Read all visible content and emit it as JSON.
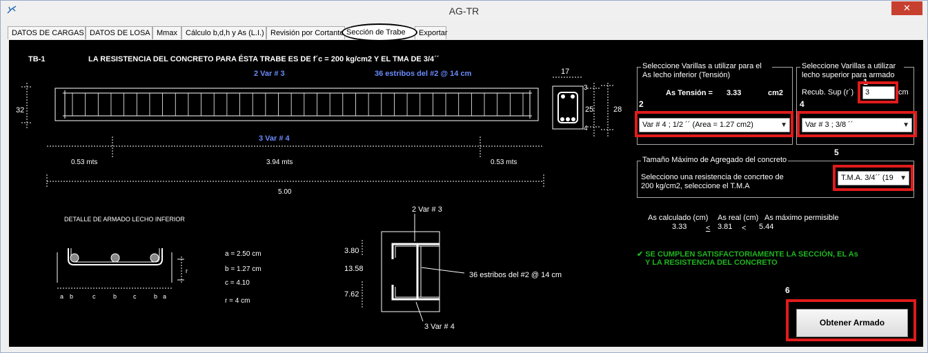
{
  "window": {
    "title": "AG-TR",
    "close_label": "✕"
  },
  "tabs": [
    {
      "label": "DATOS DE CARGAS"
    },
    {
      "label": "DATOS DE LOSA"
    },
    {
      "label": "Mmax"
    },
    {
      "label": "Cálculo b,d,h y As (L.I.)"
    },
    {
      "label": "Revisión por Cortante"
    },
    {
      "label": "Sección de Trabe"
    },
    {
      "label": "Exportar"
    }
  ],
  "header": {
    "beam_id": "TB-1",
    "resistance_text": "LA RESISTENCIA DEL CONCRETO PARA ÉSTA TRABE ES DE f´c = 200 kg/cm2 Y EL TMA DE 3/4´´",
    "top_bars": "2  Var # 3",
    "stirrups": "36 estribos del #2 @ 14 cm",
    "bottom_bars": "3  Var # 4"
  },
  "elevation": {
    "height_label": "32",
    "left_len": "0.53 mts",
    "mid_len": "3.94 mts",
    "right_len": "0.53 mts",
    "total_len": "5.00",
    "stirrup_count": 36
  },
  "cross_section": {
    "width": "17",
    "top_cover": "3",
    "inner_height": "25",
    "total_height": "28",
    "bottom_cover": "4"
  },
  "detail": {
    "title": "DETALLE DE ARMADO LECHO INFERIOR",
    "a": "a = 2.50 cm",
    "b": "b = 1.27 cm",
    "c": "c = 4.10",
    "r": "r = 4 cm",
    "r_label": "r",
    "dim_letters": [
      "a",
      "b",
      "c",
      "b",
      "c",
      "b",
      "a"
    ]
  },
  "long_section": {
    "top_label": "2   Var # 3",
    "d1": "3.80",
    "d2": "13.58",
    "d3": "7.62",
    "stirrups": "36 estribos del #2 @ 14 cm",
    "bottom_label": "3   Var # 4"
  },
  "group_bottom": {
    "label": "Seleccione Varillas a utilizar para el As lecho inferior (Tensión)",
    "as_label": "As Tensión =",
    "as_value": "3.33",
    "as_unit": "cm2",
    "combo_value": "Var # 4 ; 1/2 ´´ (Area = 1.27 cm2)",
    "step": "2"
  },
  "group_top": {
    "label": "Seleccione Varillas a utilizar lecho superior para armado",
    "cover_label": "Recub. Sup (r´)",
    "cover_value": "3",
    "cover_unit": "cm",
    "combo_value": "Var # 3 ; 3/8 ´´",
    "step_input": "1",
    "step_combo": "4"
  },
  "group_tma": {
    "label": "Tamaño Máximo de Agregado del concreto",
    "text": "Selecciono una resistencia de concrteo de 200 kg/cm2, seleccione el T.M.A",
    "combo_value": "T.M.A. 3/4´´ (19",
    "step": "5"
  },
  "as_check": {
    "calc_label": "As calculado (cm)",
    "real_label": "As real (cm)",
    "max_label": "As máximo permisible",
    "calc_value": "3.33",
    "le": "<",
    "real_value": "3.81",
    "lt": "<",
    "max_value": "5.44",
    "success_line1": "✔  SE CUMPLEN SATISFACTORIAMENTE LA SECCIÓN, EL As",
    "success_line2": "Y LA RESISTENCIA DEL CONCRETO"
  },
  "action": {
    "step": "6",
    "button_label": "Obtener Armado"
  },
  "colors": {
    "highlight_red": "#e01b1b",
    "blue_text": "#6b8cff",
    "success_green": "#1fb51f",
    "close_red": "#c7402f"
  }
}
